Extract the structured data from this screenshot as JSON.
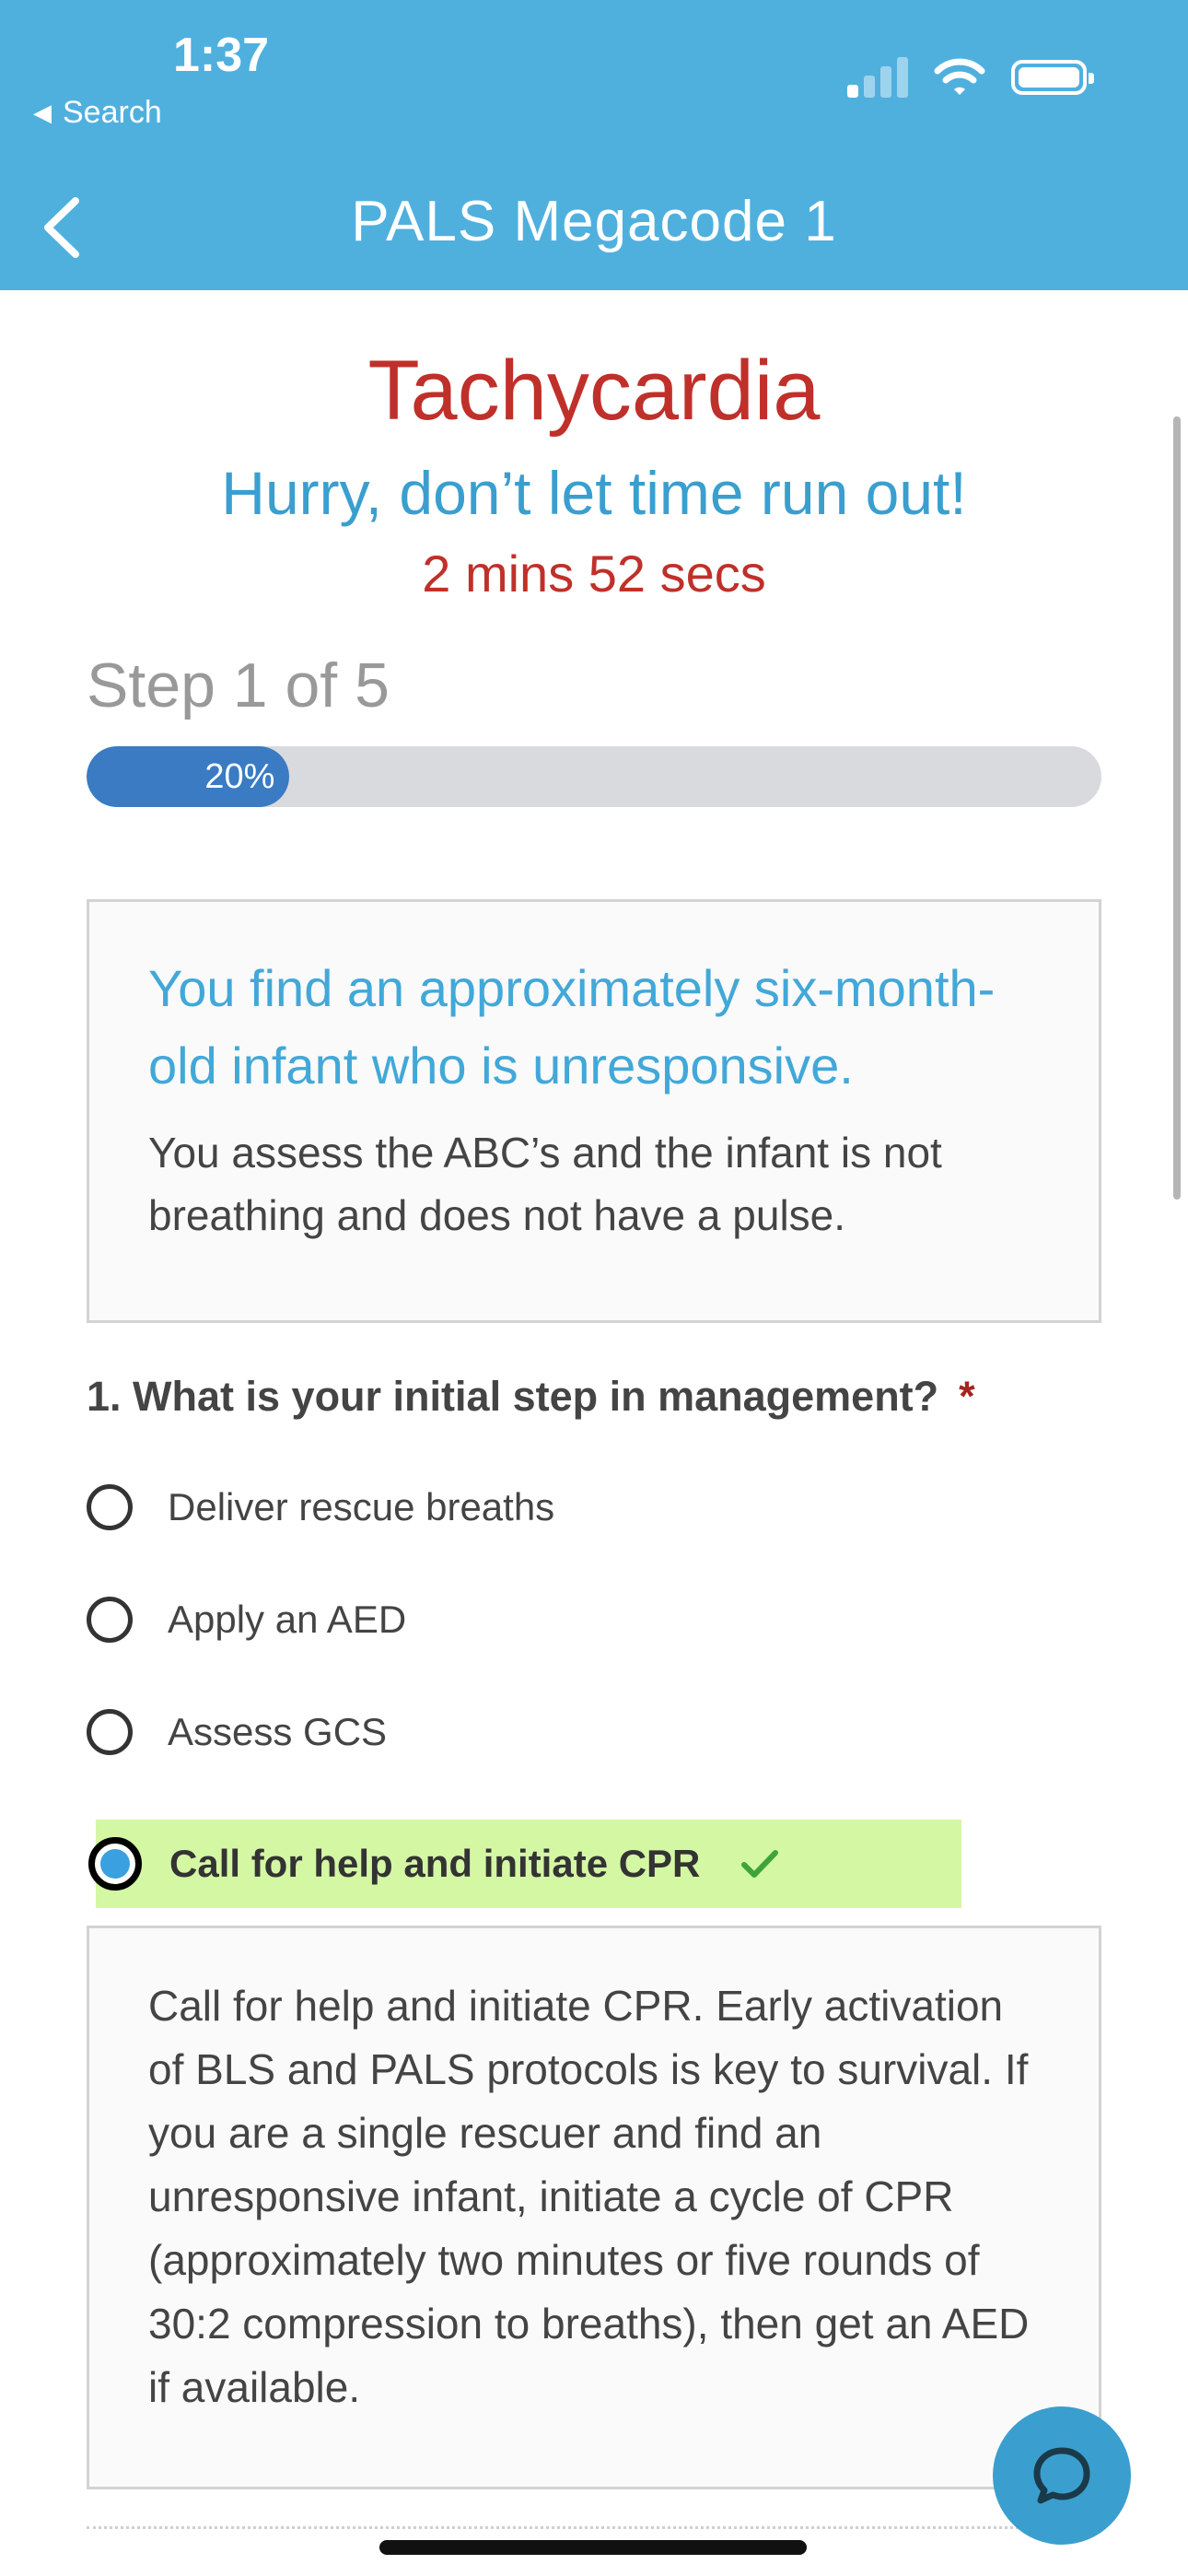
{
  "status_bar": {
    "time": "1:37",
    "back_app_label": "Search",
    "icons": [
      "cellular-signal-icon",
      "wifi-icon",
      "battery-icon"
    ]
  },
  "nav": {
    "title": "PALS Megacode 1",
    "back_icon": "chevron-left-icon"
  },
  "scenario_header": {
    "topic": "Tachycardia",
    "hurry": "Hurry, don’t let time run out!",
    "timer": "2 mins 52 secs"
  },
  "progress": {
    "step_label": "Step 1 of 5",
    "percent_label": "20%",
    "fraction": 0.2
  },
  "scenario": {
    "lead": "You find an approximately six-month-old infant who is unresponsive.",
    "detail": "You assess the ABC’s and the infant is not breathing and does not have a pulse."
  },
  "question": {
    "text": "1. What is your initial step in management?",
    "required_mark": "*",
    "options": [
      {
        "label": "Deliver rescue breaths",
        "selected": false
      },
      {
        "label": "Apply an AED",
        "selected": false
      },
      {
        "label": "Assess GCS",
        "selected": false
      },
      {
        "label": "Call for help and initiate CPR",
        "selected": true,
        "correct": true
      }
    ]
  },
  "explanation": {
    "text": "Call for help and initiate CPR. Early activation of BLS and PALS protocols is key to survival. If you are a single rescuer and find an unresponsive infant, initiate a cycle of CPR (approximately two minutes or five rounds of 30:2 compression to breaths), then get an AED if available."
  },
  "colors": {
    "header_bg": "#4FB0DE",
    "topic_red": "#C0302A",
    "accent_blue": "#3A9FCF",
    "progress_fill": "#3A7BC4",
    "correct_highlight": "#D4F7A4",
    "check_green": "#3FA33C"
  },
  "chat": {
    "icon": "chat-bubble-icon"
  }
}
